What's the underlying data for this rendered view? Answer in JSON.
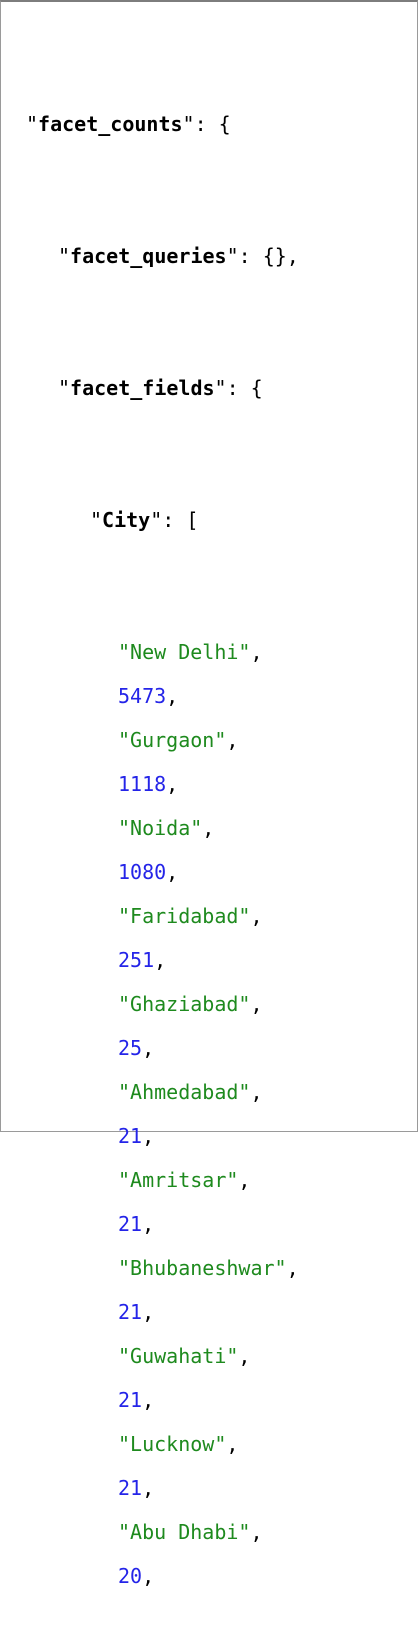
{
  "json": {
    "root_key": "facet_counts",
    "facet_queries_key": "facet_queries",
    "facet_fields_key": "facet_fields",
    "field_key": "City",
    "values": [
      {
        "city": "New Delhi",
        "count": "5473"
      },
      {
        "city": "Gurgaon",
        "count": "1118"
      },
      {
        "city": "Noida",
        "count": "1080"
      },
      {
        "city": "Faridabad",
        "count": "251"
      },
      {
        "city": "Ghaziabad",
        "count": "25"
      },
      {
        "city": "Ahmedabad",
        "count": "21"
      },
      {
        "city": "Amritsar",
        "count": "21"
      },
      {
        "city": "Bhubaneshwar",
        "count": "21"
      },
      {
        "city": "Guwahati",
        "count": "21"
      },
      {
        "city": "Lucknow",
        "count": "21"
      },
      {
        "city": "Abu Dhabi",
        "count": "20"
      }
    ]
  },
  "colors": {
    "key": "#000000",
    "string": "#1e8a1e",
    "number": "#2424e8"
  }
}
